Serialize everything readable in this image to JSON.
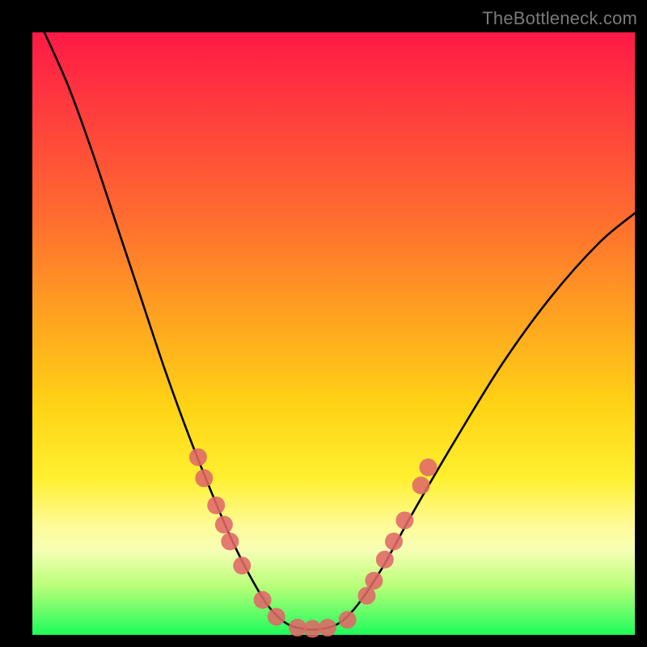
{
  "watermark": "TheBottleneck.com",
  "chart_data": {
    "type": "line",
    "title": "",
    "xlabel": "",
    "ylabel": "",
    "xlim": [
      0,
      1
    ],
    "ylim": [
      0,
      1
    ],
    "grid": false,
    "legend": false,
    "series": [
      {
        "name": "bottleneck-curve",
        "x": [
          0.02,
          0.06,
          0.1,
          0.14,
          0.18,
          0.22,
          0.26,
          0.3,
          0.33,
          0.36,
          0.39,
          0.42,
          0.45,
          0.48,
          0.51,
          0.54,
          0.58,
          0.63,
          0.7,
          0.78,
          0.86,
          0.94,
          1.0
        ],
        "y": [
          1.0,
          0.91,
          0.8,
          0.68,
          0.56,
          0.44,
          0.33,
          0.23,
          0.16,
          0.1,
          0.05,
          0.02,
          0.01,
          0.01,
          0.02,
          0.05,
          0.11,
          0.2,
          0.32,
          0.45,
          0.56,
          0.65,
          0.7
        ]
      }
    ],
    "markers": {
      "name": "highlight-dots",
      "color": "#e06868",
      "radius_px": 11,
      "points": [
        {
          "x": 0.275,
          "y": 0.295
        },
        {
          "x": 0.285,
          "y": 0.26
        },
        {
          "x": 0.305,
          "y": 0.215
        },
        {
          "x": 0.318,
          "y": 0.183
        },
        {
          "x": 0.328,
          "y": 0.155
        },
        {
          "x": 0.348,
          "y": 0.115
        },
        {
          "x": 0.382,
          "y": 0.058
        },
        {
          "x": 0.405,
          "y": 0.03
        },
        {
          "x": 0.44,
          "y": 0.012
        },
        {
          "x": 0.465,
          "y": 0.01
        },
        {
          "x": 0.49,
          "y": 0.012
        },
        {
          "x": 0.523,
          "y": 0.025
        },
        {
          "x": 0.555,
          "y": 0.065
        },
        {
          "x": 0.567,
          "y": 0.09
        },
        {
          "x": 0.585,
          "y": 0.125
        },
        {
          "x": 0.6,
          "y": 0.155
        },
        {
          "x": 0.618,
          "y": 0.19
        },
        {
          "x": 0.645,
          "y": 0.248
        },
        {
          "x": 0.657,
          "y": 0.278
        }
      ]
    }
  }
}
